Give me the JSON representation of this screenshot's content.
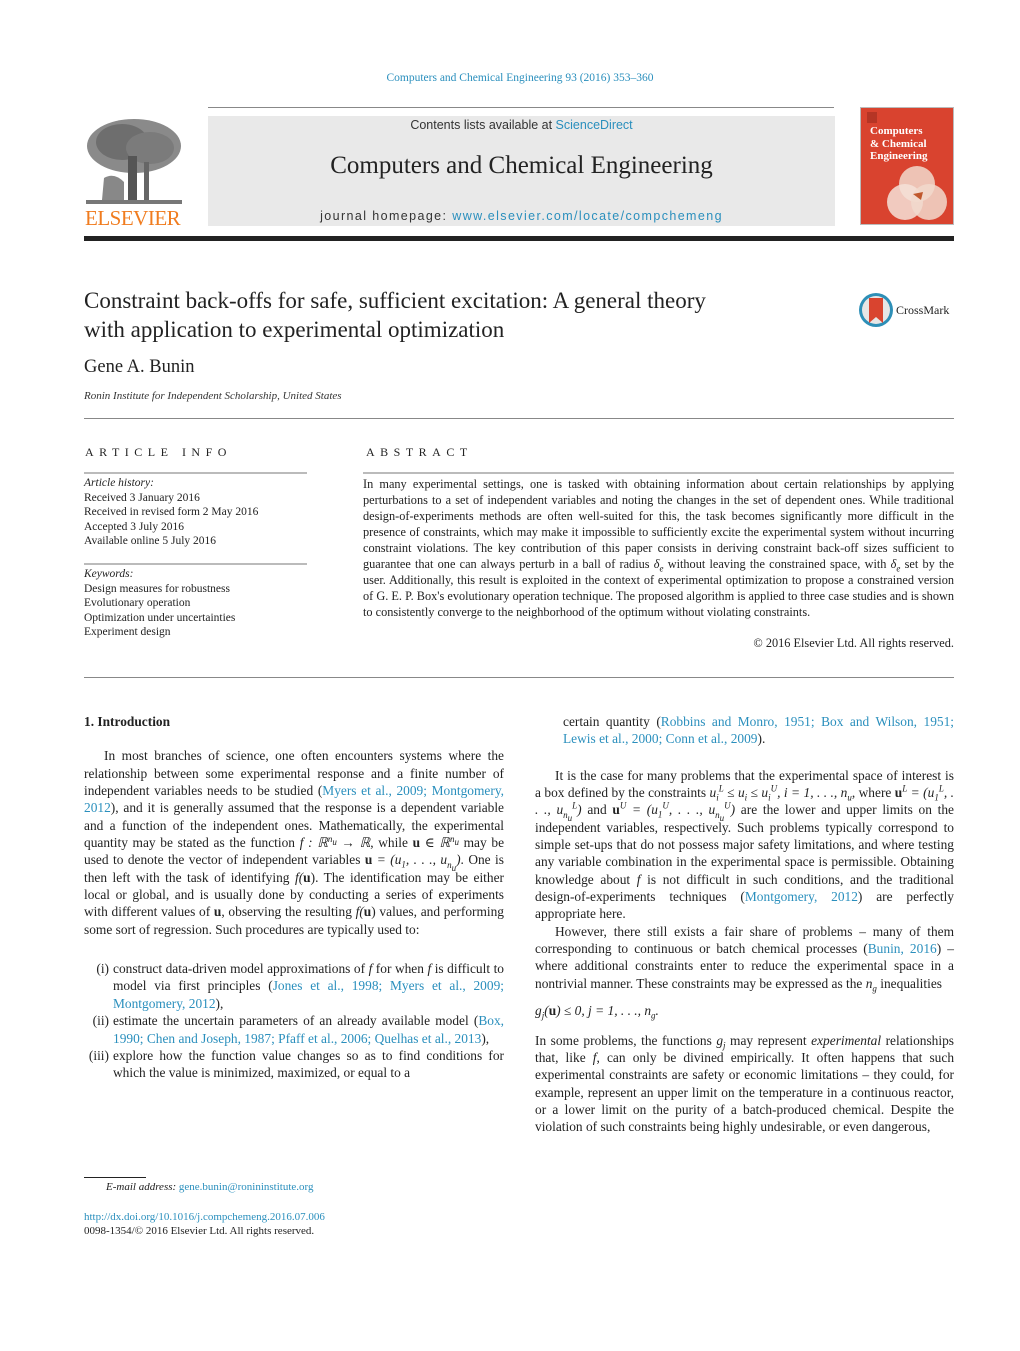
{
  "journal_citation": "Computers and Chemical Engineering 93 (2016) 353–360",
  "header": {
    "publisher_logo_text": "ELSEVIER",
    "contents_prefix": "Contents lists available at ",
    "contents_link": "ScienceDirect",
    "journal_name": "Computers and Chemical Engineering",
    "homepage_prefix": "journal homepage: ",
    "homepage_link": "www.elsevier.com/locate/compchemeng",
    "cover_title_lines": [
      "Computers",
      "& Chemical",
      "Engineering"
    ]
  },
  "article": {
    "title_line1": "Constraint back-offs for safe, sufficient excitation: A general theory",
    "title_line2": "with application to experimental optimization",
    "crossmark_label": "CrossMark",
    "author": "Gene A. Bunin",
    "affiliation": "Ronin Institute for Independent Scholarship, United States"
  },
  "article_info": {
    "heading": "ARTICLE INFO",
    "history_label": "Article history:",
    "history": [
      "Received 3 January 2016",
      "Received in revised form 2 May 2016",
      "Accepted 3 July 2016",
      "Available online 5 July 2016"
    ],
    "keywords_label": "Keywords:",
    "keywords": [
      "Design measures for robustness",
      "Evolutionary operation",
      "Optimization under uncertainties",
      "Experiment design"
    ]
  },
  "abstract": {
    "heading": "ABSTRACT",
    "part1": "In many experimental settings, one is tasked with obtaining information about certain relationships by applying perturbations to a set of independent variables and noting the changes in the set of dependent ones. While traditional design-of-experiments methods are often well-suited for this, the task becomes significantly more difficult in the presence of constraints, which may make it impossible to sufficiently excite the experimental system without incurring constraint violations. The key contribution of this paper consists in deriving constraint back-off sizes sufficient to guarantee that one can always perturb in a ball of radius ",
    "delta": "δ",
    "delta_sub": "e",
    "part2": " without leaving the constrained space, with ",
    "part3": " set by the user. Additionally, this result is exploited in the context of experimental optimization to propose a constrained version of G. E. P. Box's evolutionary operation technique. The proposed algorithm is applied to three case studies and is shown to consistently converge to the neighborhood of the optimum without violating constraints.",
    "copyright": "© 2016 Elsevier Ltd. All rights reserved."
  },
  "body": {
    "section_heading": "1.  Introduction",
    "p1_a": "In most branches of science, one often encounters systems where the relationship between some experimental response and a finite number of independent variables needs to be studied (",
    "p1_cite1": "Myers et al., 2009; Montgomery, 2012",
    "p1_b": "), and it is generally assumed that the response is a dependent variable and a function of the independent ones. Mathematically, the experimental quantity may be stated as the function ",
    "p1_math1": "f : ℝ",
    "p1_nu": "n",
    "p1_nu_sub": "u",
    "p1_math2": " → ℝ",
    "p1_c": ", while ",
    "p1_u": "u",
    "p1_in": " ∈ ℝ",
    "p1_d": " may be used to denote the vector of independent variables ",
    "p1_vec": " = (u",
    "p1_vec_sub1": "1",
    "p1_vec_mid": ", . . ., u",
    "p1_vec_end": ")",
    "p1_e": ". One is then left with the task of identifying ",
    "p1_fu": "f(",
    "p1_fu_end": ")",
    "p1_f": ". The identification may be either local or global, and is usually done by conducting a series of experiments with different values of ",
    "p1_g": ", observing the resulting ",
    "p1_h": " values, and performing some sort of regression. Such procedures are typically used to:",
    "list": [
      {
        "num": "(i)",
        "a": "construct data-driven model approximations of ",
        "f1": "f",
        "b": " for when ",
        "f2": "f",
        "c": " is difficult to model via first principles (",
        "cite": "Jones et al., 1998; Myers et al., 2009; Montgomery, 2012",
        "d": "),"
      },
      {
        "num": "(ii)",
        "a": "estimate the uncertain parameters of an already available model (",
        "cite": "Box, 1990; Chen and Joseph, 1987; Pfaff et al., 2006; Quelhas et al., 2013",
        "d": "),"
      },
      {
        "num": "(iii)",
        "a": "explore how the function value changes so as to find conditions for which the value is minimized, maximized, or equal to a"
      }
    ],
    "list_cont_a": "certain quantity (",
    "list_cont_cite": "Robbins and Monro, 1951; Box and Wilson, 1951; Lewis et al., 2000; Conn et al., 2009",
    "list_cont_b": ").",
    "p2_a": "It is the case for many problems that the experimental space of interest is a box defined by the constraints ",
    "p2_b": ",   i = 1, . . ., n",
    "p2_c": ", where ",
    "p2_d": " and ",
    "p2_e": " are the lower and upper limits on the independent variables, respectively. Such problems typically correspond to simple set-ups that do not possess major safety limitations, and where testing any variable combination in the experimental space is permissible. Obtaining knowledge about ",
    "p2_f": "f",
    "p2_g": " is not difficult in such conditions, and the traditional design-of-experiments techniques (",
    "p2_cite": "Montgomery, 2012",
    "p2_h": ") are perfectly appropriate here.",
    "p3_a": "However, there still exists a fair share of problems – many of them corresponding to continuous or batch chemical processes (",
    "p3_cite": "Bunin, 2016",
    "p3_b": ") – where additional constraints enter to reduce the experimental space in a nontrivial manner. These constraints may be expressed as the ",
    "p3_ng": "n",
    "p3_ng_sub": "g",
    "p3_c": " inequalities",
    "eq_g": "g",
    "eq_j": "j",
    "eq_rest": " ≤ 0,    j = 1, . . ., n",
    "eq_end": ".",
    "p4_a": "In some problems, the functions ",
    "p4_b": " may represent ",
    "p4_em": "experimental",
    "p4_c": " relationships that, like ",
    "p4_f": "f",
    "p4_d": ", can only be divined empirically. It often happens that such experimental constraints are safety or economic limitations – they could, for example, represent an upper limit on the temperature in a continuous reactor, or a lower limit on the purity of a batch-produced chemical. Despite the violation of such constraints being highly undesirable, or even dangerous,"
  },
  "footnote": {
    "email_label": "E-mail address: ",
    "email": "gene.bunin@ronininstitute.org",
    "doi": "http://dx.doi.org/10.1016/j.compchemeng.2016.07.006",
    "issn": "0098-1354/© 2016 Elsevier Ltd. All rights reserved."
  }
}
